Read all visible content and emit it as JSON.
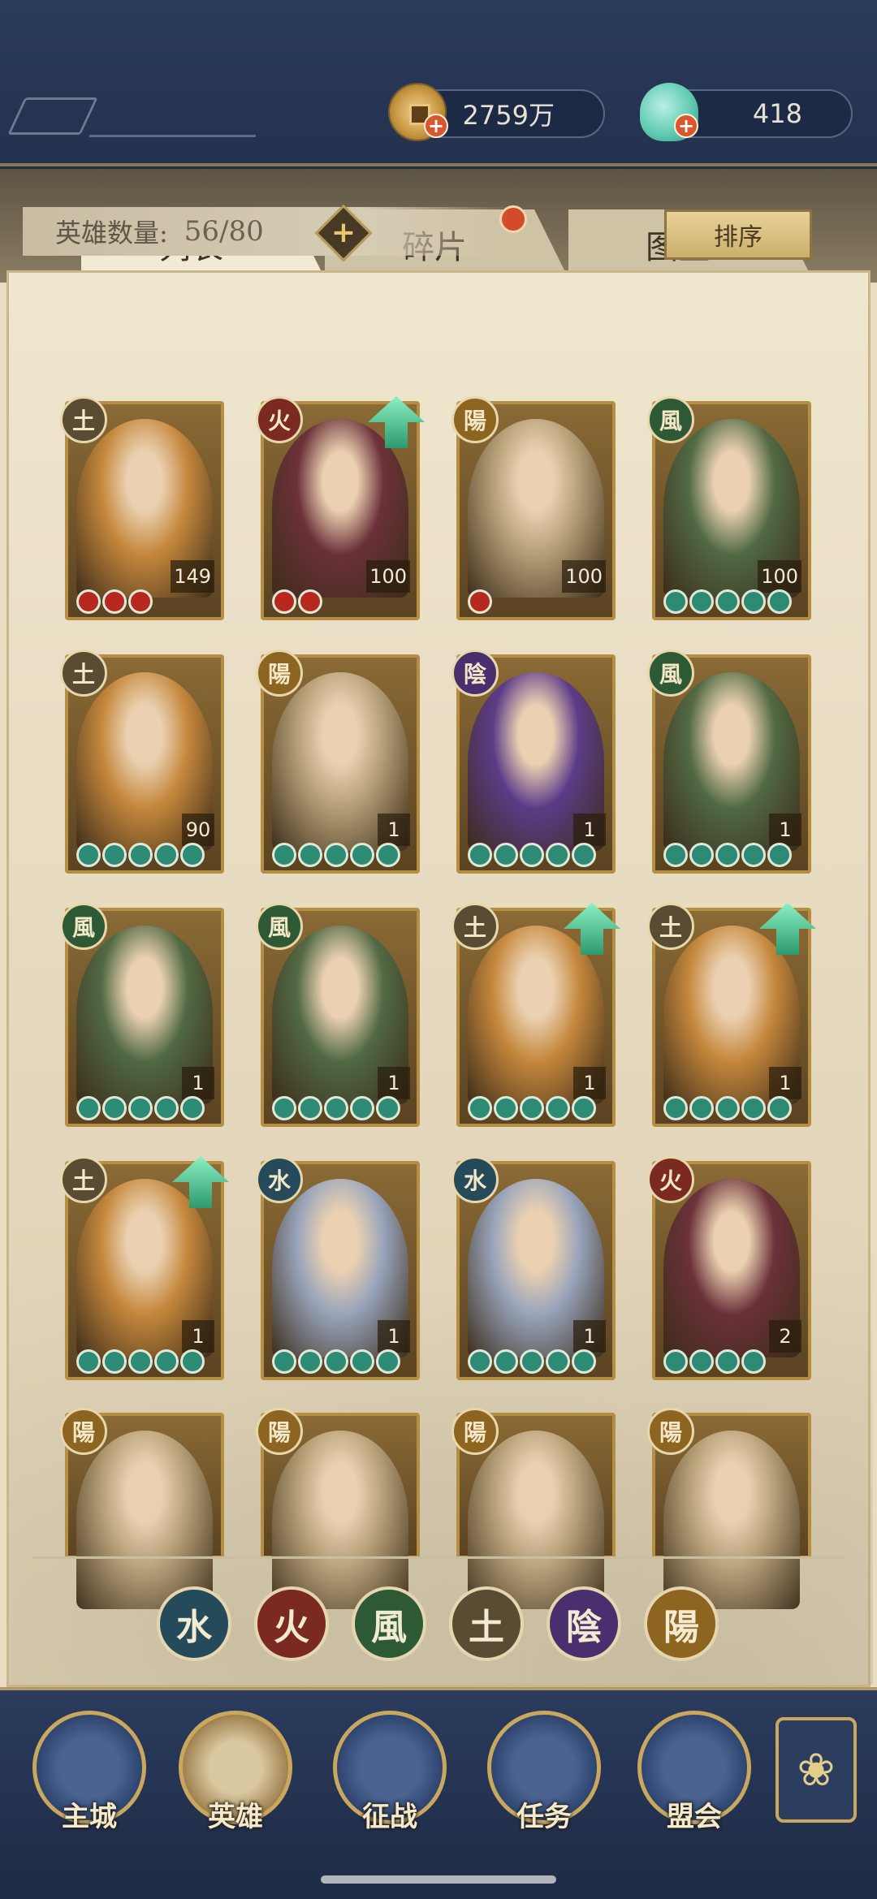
{
  "resources": {
    "coins": "2759万",
    "jade": "418"
  },
  "tabs": [
    {
      "label": "列表",
      "active": true
    },
    {
      "label": "碎片",
      "active": false
    },
    {
      "label": "图鉴",
      "active": false
    }
  ],
  "hero_count": {
    "label": "英雄数量:",
    "value": "56/80"
  },
  "sort_label": "排序",
  "heroes": [
    {
      "element": "土",
      "level": "149",
      "stars": 3,
      "star_color": "red",
      "upgrade": false
    },
    {
      "element": "火",
      "level": "100",
      "stars": 2,
      "star_color": "red",
      "upgrade": true
    },
    {
      "element": "陽",
      "level": "100",
      "stars": 1,
      "star_color": "red",
      "upgrade": false
    },
    {
      "element": "風",
      "level": "100",
      "stars": 5,
      "star_color": "green",
      "upgrade": false
    },
    {
      "element": "土",
      "level": "90",
      "stars": 5,
      "star_color": "green",
      "upgrade": false
    },
    {
      "element": "陽",
      "level": "1",
      "stars": 5,
      "star_color": "green",
      "upgrade": false
    },
    {
      "element": "陰",
      "level": "1",
      "stars": 5,
      "star_color": "green",
      "upgrade": false
    },
    {
      "element": "風",
      "level": "1",
      "stars": 5,
      "star_color": "green",
      "upgrade": false
    },
    {
      "element": "風",
      "level": "1",
      "stars": 5,
      "star_color": "green",
      "upgrade": false
    },
    {
      "element": "風",
      "level": "1",
      "stars": 5,
      "star_color": "green",
      "upgrade": false
    },
    {
      "element": "土",
      "level": "1",
      "stars": 5,
      "star_color": "green",
      "upgrade": true
    },
    {
      "element": "土",
      "level": "1",
      "stars": 5,
      "star_color": "green",
      "upgrade": true
    },
    {
      "element": "土",
      "level": "1",
      "stars": 5,
      "star_color": "green",
      "upgrade": true
    },
    {
      "element": "水",
      "level": "1",
      "stars": 5,
      "star_color": "green",
      "upgrade": false
    },
    {
      "element": "水",
      "level": "1",
      "stars": 5,
      "star_color": "green",
      "upgrade": false
    },
    {
      "element": "火",
      "level": "2",
      "stars": 4,
      "star_color": "green",
      "upgrade": false
    },
    {
      "element": "陽",
      "level": "",
      "stars": 0,
      "star_color": "green",
      "upgrade": false
    },
    {
      "element": "陽",
      "level": "",
      "stars": 0,
      "star_color": "green",
      "upgrade": false
    },
    {
      "element": "陽",
      "level": "",
      "stars": 0,
      "star_color": "green",
      "upgrade": false
    },
    {
      "element": "陽",
      "level": "",
      "stars": 0,
      "star_color": "green",
      "upgrade": false
    }
  ],
  "filters": [
    {
      "label": "水",
      "color": "#254a5a"
    },
    {
      "label": "火",
      "color": "#7a2a20"
    },
    {
      "label": "風",
      "color": "#2d5a35"
    },
    {
      "label": "土",
      "color": "#5a4b33"
    },
    {
      "label": "陰",
      "color": "#4a2f6e"
    },
    {
      "label": "陽",
      "color": "#8d6420"
    }
  ],
  "nav": [
    {
      "label": "主城",
      "icon": "castle-icon"
    },
    {
      "label": "英雄",
      "icon": "hero-portrait-icon"
    },
    {
      "label": "征战",
      "icon": "battle-icon"
    },
    {
      "label": "任务",
      "icon": "scroll-icon"
    },
    {
      "label": "盟会",
      "icon": "guild-icon"
    }
  ]
}
